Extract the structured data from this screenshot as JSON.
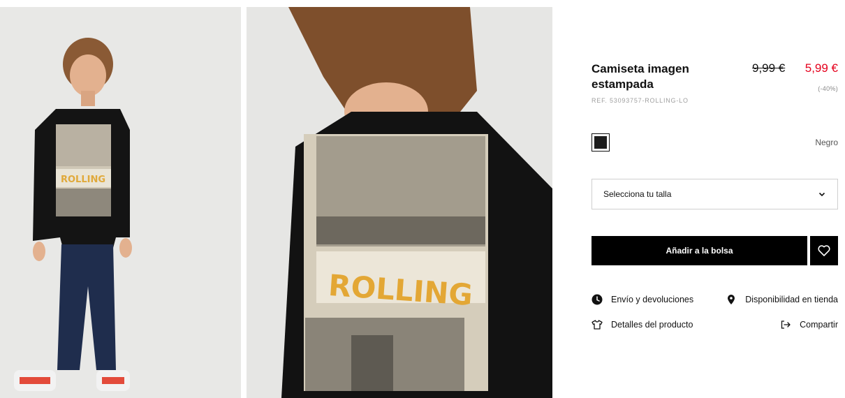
{
  "product": {
    "title": "Camiseta imagen estampada",
    "old_price": "9,99 €",
    "new_price": "5,99 €",
    "discount": "(-40%)",
    "reference": "REF. 53093757-ROLLING-LO"
  },
  "images": {
    "print_text": "ROLLING"
  },
  "color": {
    "name": "Negro",
    "swatch_hex": "#1c1c1c"
  },
  "size_selector": {
    "placeholder": "Selecciona tu talla"
  },
  "actions": {
    "add_to_bag": "Añadir a la bolsa"
  },
  "links": {
    "shipping": "Envío y devoluciones",
    "store_availability": "Disponibilidad en tienda",
    "product_details": "Detalles del producto",
    "share": "Compartir"
  },
  "colors": {
    "sale_red": "#e5001c",
    "button_black": "#000000"
  }
}
